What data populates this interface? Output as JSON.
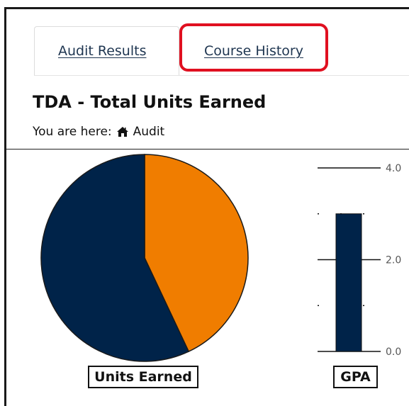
{
  "tabs": {
    "audit_results": "Audit Results",
    "course_history": "Course History"
  },
  "page": {
    "title": "TDA - Total Units Earned",
    "breadcrumb_prefix": "You are here:",
    "breadcrumb_current": "Audit",
    "breadcrumb_icon": "home-icon"
  },
  "colors": {
    "navy": "#002349",
    "orange": "#f07d00",
    "highlight": "#e01020"
  },
  "charts": {
    "units_label": "Units Earned",
    "gpa_label": "GPA"
  },
  "chart_data": [
    {
      "type": "pie",
      "title": "Units Earned",
      "slices": [
        {
          "value": 43
        },
        {
          "value": 57
        }
      ]
    },
    {
      "type": "bar",
      "title": "GPA",
      "ylim": [
        0,
        4
      ],
      "ticks": [
        "4.0",
        "2.0",
        "0.0"
      ],
      "values": [
        3.0
      ]
    }
  ]
}
